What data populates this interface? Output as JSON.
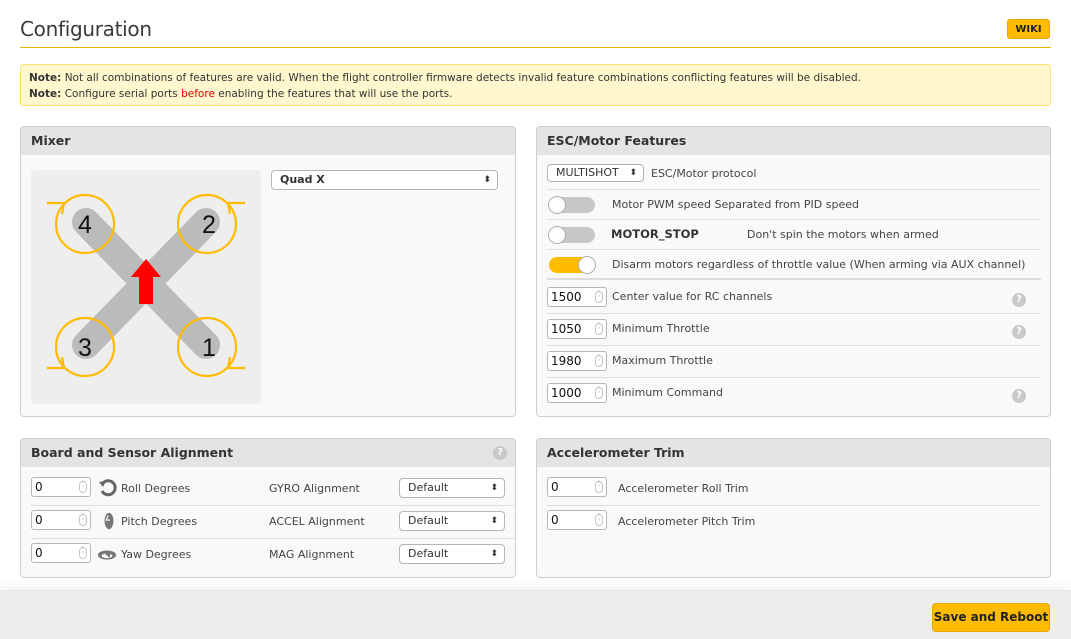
{
  "header": {
    "title": "Configuration",
    "wiki_label": "WIKI"
  },
  "notes": [
    {
      "prefix": "Note:",
      "text": "Not all combinations of features are valid. When the flight controller firmware detects invalid feature combinations conflicting features will be disabled."
    },
    {
      "prefix": "Note:",
      "text_before": "Configure serial ports",
      "highlight": "before",
      "text_after": "enabling the features that will use the ports."
    }
  ],
  "mixer": {
    "title": "Mixer",
    "selected": "Quad X",
    "motors": [
      "1",
      "2",
      "3",
      "4"
    ],
    "colors": {
      "prop": "#ffbb00",
      "arm": "#bbbbbb",
      "arrow": "#ff0000"
    }
  },
  "esc": {
    "title": "ESC/Motor Features",
    "protocol": {
      "value": "MULTISHOT",
      "label": "ESC/Motor protocol"
    },
    "toggles": [
      {
        "label": "Motor PWM speed Separated from PID speed",
        "on": false
      },
      {
        "name": "MOTOR_STOP",
        "label": "Don't spin the motors when armed",
        "on": false
      },
      {
        "label": "Disarm motors regardless of throttle value (When arming via AUX channel)",
        "on": true
      }
    ],
    "numbers": [
      {
        "value": "1500",
        "label": "Center value for RC channels",
        "help": true
      },
      {
        "value": "1050",
        "label": "Minimum Throttle",
        "help": true
      },
      {
        "value": "1980",
        "label": "Maximum Throttle",
        "help": false
      },
      {
        "value": "1000",
        "label": "Minimum Command",
        "help": true
      }
    ]
  },
  "board": {
    "title": "Board and Sensor Alignment",
    "rows": [
      {
        "value": "0",
        "icon": "roll-icon",
        "label": "Roll Degrees",
        "align_label": "GYRO Alignment",
        "align_value": "Default"
      },
      {
        "value": "0",
        "icon": "pitch-icon",
        "label": "Pitch Degrees",
        "align_label": "ACCEL Alignment",
        "align_value": "Default"
      },
      {
        "value": "0",
        "icon": "yaw-icon",
        "label": "Yaw Degrees",
        "align_label": "MAG Alignment",
        "align_value": "Default"
      }
    ]
  },
  "accel": {
    "title": "Accelerometer Trim",
    "rows": [
      {
        "value": "0",
        "label": "Accelerometer Roll Trim"
      },
      {
        "value": "0",
        "label": "Accelerometer Pitch Trim"
      }
    ]
  },
  "footer": {
    "save_label": "Save and Reboot"
  },
  "icons": {
    "help": "?",
    "select_arrows": "⬍",
    "spin": "⌃⌄"
  },
  "colors": {
    "accent": "#ffbb00",
    "note_bg": "#fff8ce",
    "note_highlight": "#e20000"
  }
}
